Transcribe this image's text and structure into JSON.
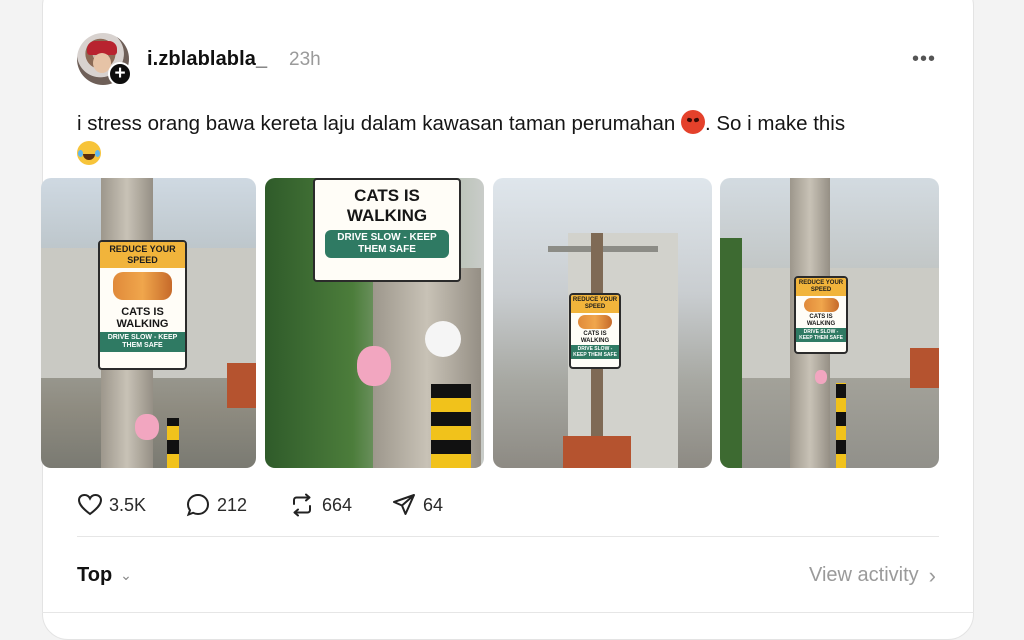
{
  "post": {
    "username": "i.zblablabla_",
    "time": "23h",
    "more_icon": "more-horizontal-icon",
    "follow_icon": "plus-icon",
    "text": "i stress orang bawa kereta laju dalam kawasan taman perumahan",
    "text_after_emoji": ". So i make this"
  },
  "photos": {
    "sign_top": "REDUCE YOUR SPEED",
    "sign_middle": "CATS IS WALKING",
    "sign_bottom": "DRIVE SLOW - KEEP THEM SAFE",
    "sign_crop_top": "CATS IS WALKING",
    "sign_crop_bottom": "DRIVE SLOW - KEEP THEM SAFE"
  },
  "actions": {
    "likes": "3.5K",
    "comments": "212",
    "reposts": "664",
    "shares": "64"
  },
  "footer": {
    "sort_label": "Top",
    "view_activity": "View activity"
  },
  "colors": {
    "sign_band": "#f1b43b",
    "sign_drive": "#2f7a63"
  }
}
